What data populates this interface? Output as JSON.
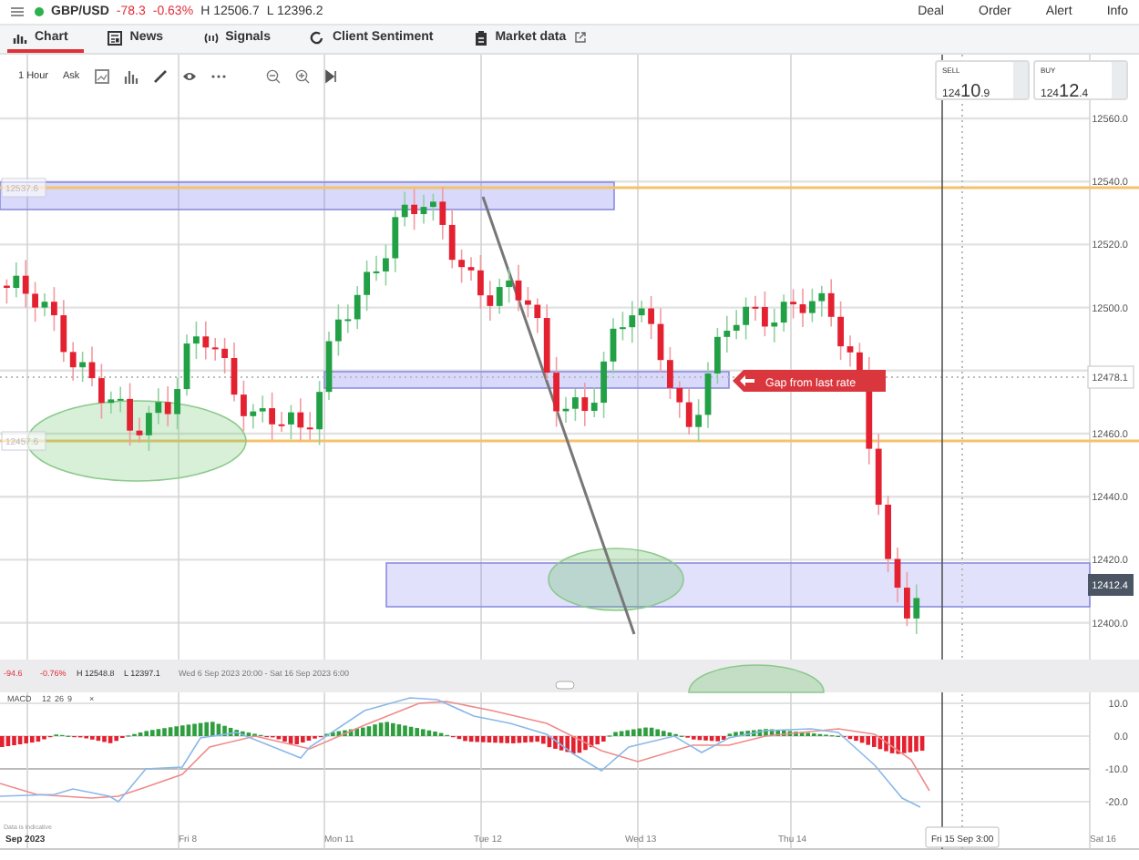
{
  "instrument": {
    "symbol": "GBP/USD",
    "change": "-78.3",
    "change_pct": "-0.63%",
    "high": "H 12506.7",
    "low": "L 12396.2"
  },
  "actions": [
    "Deal",
    "Order",
    "Alert",
    "Info"
  ],
  "tabs": [
    {
      "label": "Chart",
      "selected": true
    },
    {
      "label": "News",
      "selected": false
    },
    {
      "label": "Signals",
      "selected": false
    },
    {
      "label": "Client Sentiment",
      "selected": false
    },
    {
      "label": "Market data",
      "selected": false
    }
  ],
  "toolbar": {
    "interval": "1 Hour",
    "price_type": "Ask"
  },
  "quotes": [
    {
      "label": "SELL",
      "price_lead": "124",
      "price_main": "10",
      "price_tail": ".9"
    },
    {
      "label": "BUY",
      "price_lead": "124",
      "price_main": "12",
      "price_tail": ".4"
    }
  ],
  "chart": {
    "price_axis": [
      "12560.0",
      "12540.0",
      "12520.0",
      "12500.0",
      "12460.0",
      "12440.0",
      "12420.0",
      "12400.0"
    ],
    "marked_price": "12478.1",
    "current_price": "12412.4",
    "level_labels": [
      "12537.6",
      "12457.6"
    ],
    "annotation": "Gap from last rate",
    "time_axis": [
      "Sep 2023",
      "Fri 8",
      "Mon 11",
      "Tue 12",
      "Wed 13",
      "Thu 14",
      "Sat 16"
    ],
    "crosshair_time": "Fri 15 Sep 3:00"
  },
  "navigator": {
    "change": "-94.6",
    "change_pct": "-0.76%",
    "high": "H 12548.8",
    "low": "L 12397.1",
    "range": "Wed 6 Sep 2023 20:00 - Sat 16 Sep 2023 6:00"
  },
  "macd": {
    "name": "MACD",
    "params": [
      "12",
      "26",
      "9"
    ],
    "close": "×",
    "axis": [
      "10.0",
      "0.0",
      "-10.0",
      "-20.0"
    ]
  },
  "disclaimer": "Data is indicative"
}
